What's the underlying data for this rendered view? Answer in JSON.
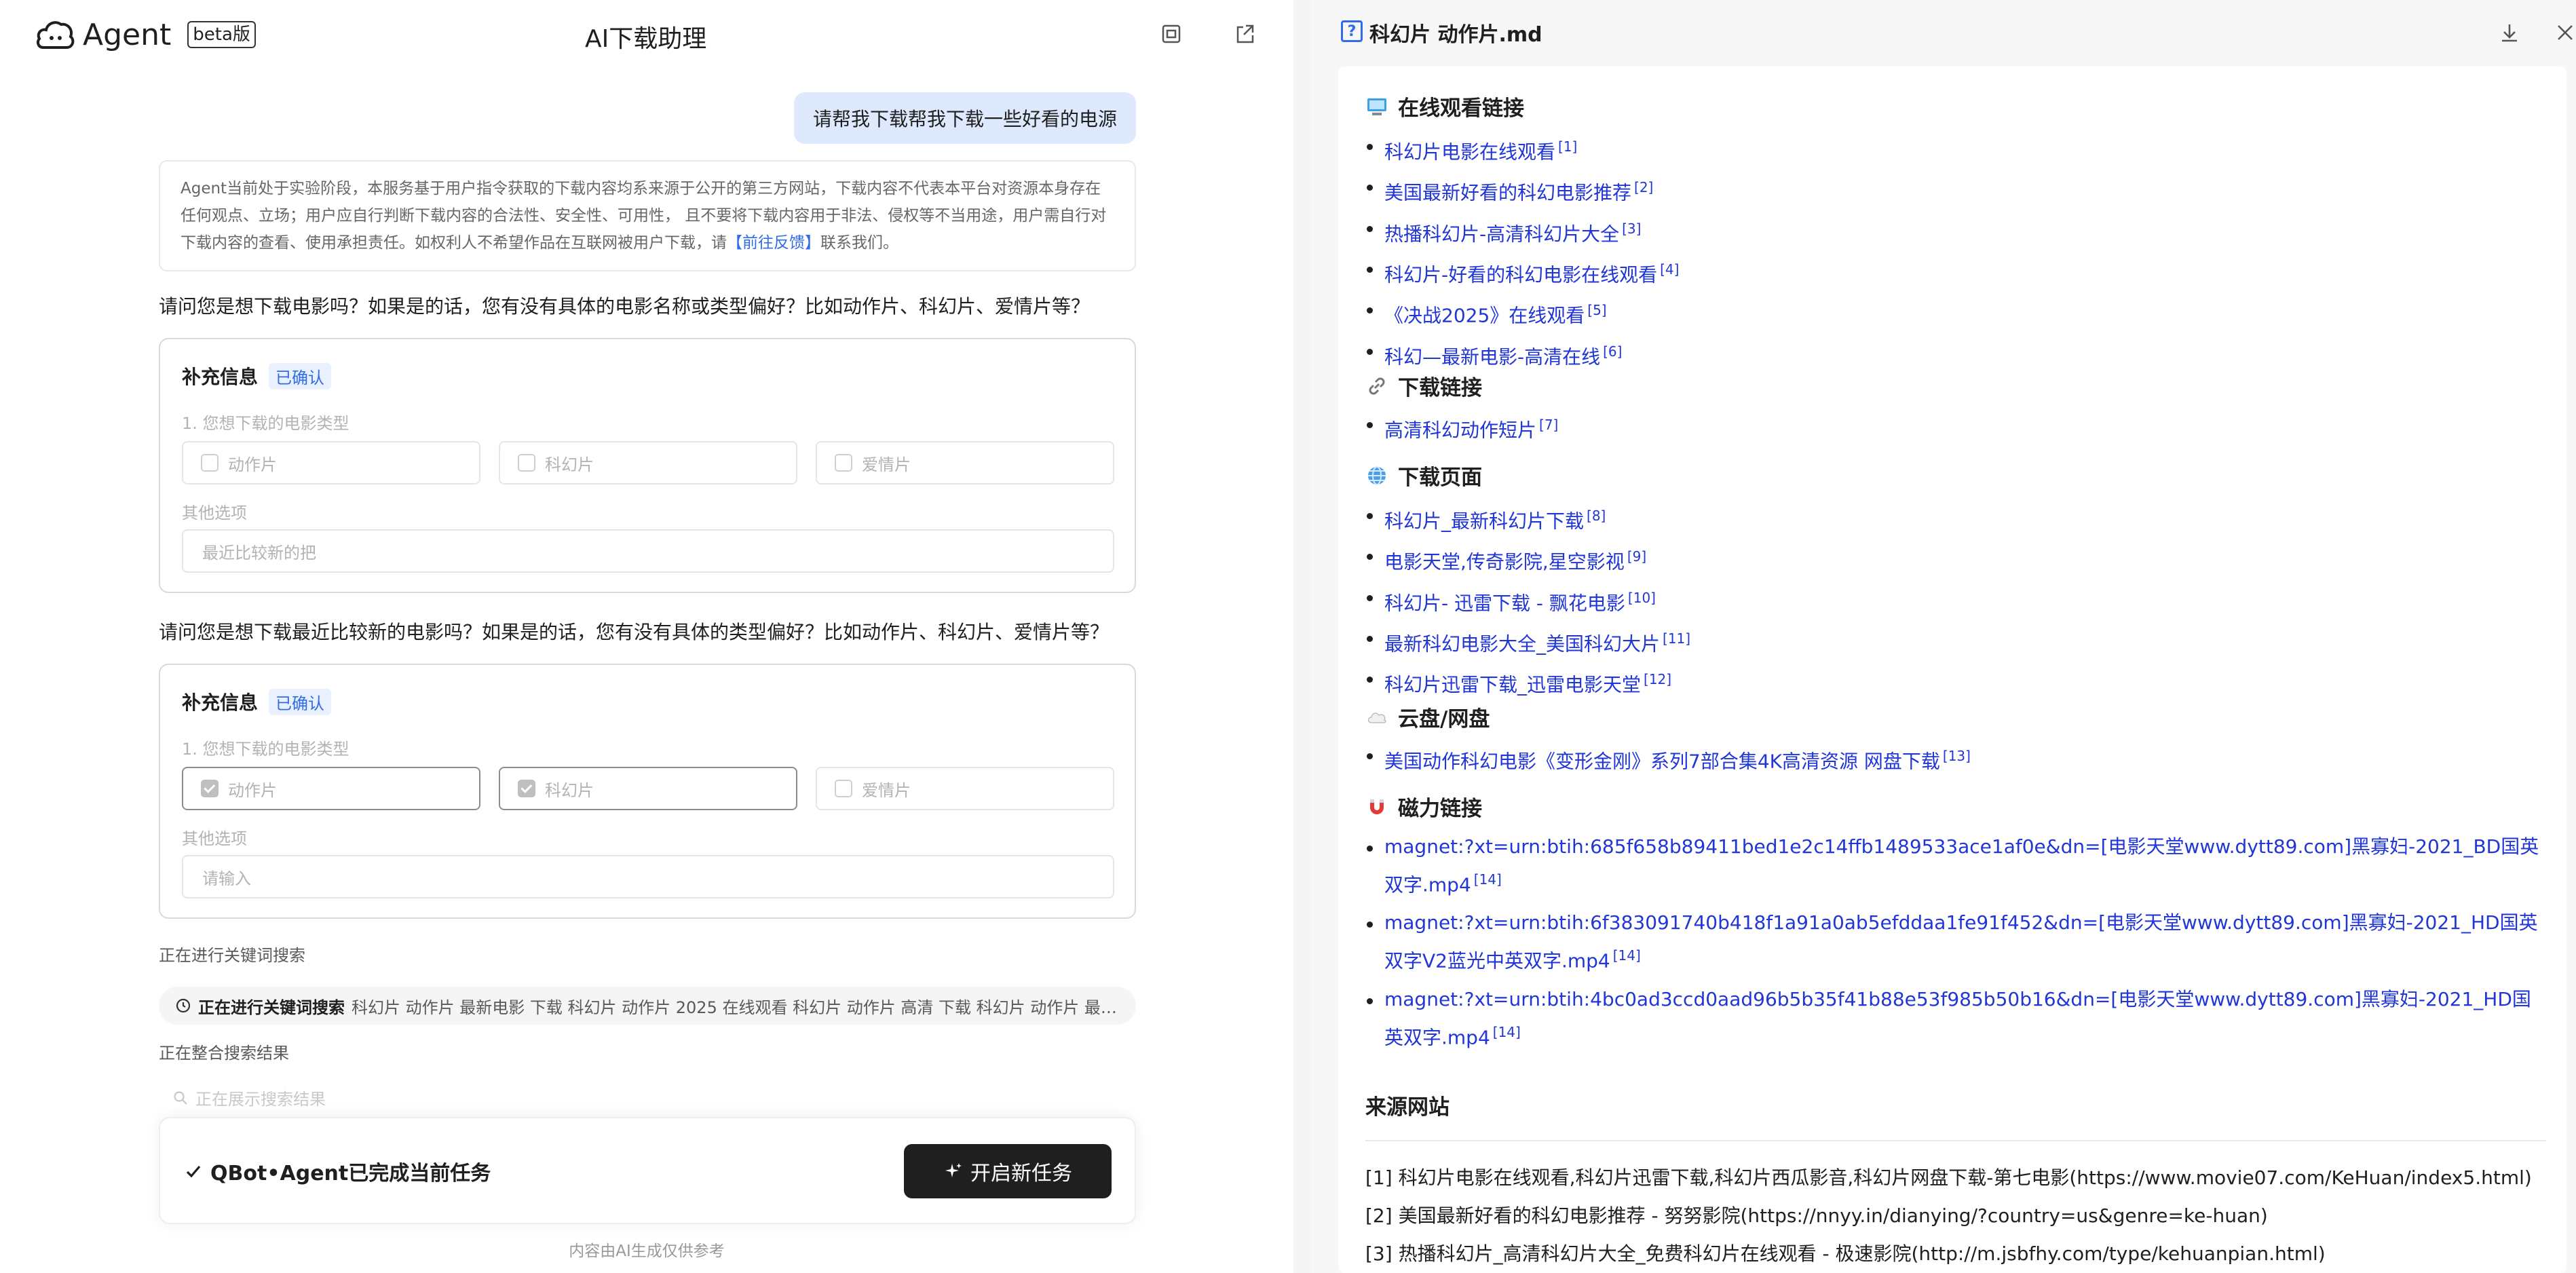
{
  "header": {
    "logo_text": "Agent",
    "beta": "beta版",
    "title": "AI下载助理"
  },
  "chat": {
    "user_message": "请帮我下载帮我下载一些好看的电源",
    "disclaimer": "Agent当前处于实验阶段，本服务基于用户指令获取的下载内容均系来源于公开的第三方网站，下载内容不代表本平台对资源本身存在任何观点、立场；用户应自行判断下载内容的合法性、安全性、可用性， 且不要将下载内容用于非法、侵权等不当用途，用户需自行对下载内容的查看、使用承担责任。如权利人不希望作品在互联网被用户下载，请",
    "disclaimer_link": "【前往反馈】",
    "disclaimer_tail": "联系我们。",
    "question1": "请问您是想下载电影吗？如果是的话，您有没有具体的电影名称或类型偏好？比如动作片、科幻片、爱情片等？",
    "question2": "请问您是想下载最近比较新的电影吗？如果是的话，您有没有具体的类型偏好？比如动作片、科幻片、爱情片等？",
    "card1": {
      "title": "补充信息",
      "badge": "已确认",
      "label1": "1. 您想下载的电影类型",
      "options": [
        "动作片",
        "科幻片",
        "爱情片"
      ],
      "label2": "其他选项",
      "field_value": "最近比较新的把"
    },
    "card2": {
      "title": "补充信息",
      "badge": "已确认",
      "label1": "1. 您想下载的电影类型",
      "options": [
        "动作片",
        "科幻片",
        "爱情片"
      ],
      "checked": [
        true,
        true,
        false
      ],
      "label2": "其他选项",
      "field_placeholder": "请输入"
    },
    "status_keyword": "正在进行关键词搜索",
    "search_bold": "正在进行关键词搜索",
    "search_keywords": "科幻片 动作片 最新电影 下载 科幻片 动作片 2025 在线观看 科幻片 动作片 高清 下载 科幻片 动作片 最新...",
    "status_merge": "正在整合搜索结果",
    "status_show": "正在展示搜索结果",
    "done_text": "QBot•Agent已完成当前任务",
    "new_task": "开启新任务",
    "footer_note": "内容由AI生成仅供参考"
  },
  "doc": {
    "title": "科幻片 动作片.md",
    "sections": {
      "online": {
        "title": "在线观看链接",
        "items": [
          {
            "text": "科幻片电影在线观看",
            "ref": "[1]"
          },
          {
            "text": "美国最新好看的科幻电影推荐",
            "ref": "[2]"
          },
          {
            "text": "热播科幻片-高清科幻片大全",
            "ref": "[3]"
          },
          {
            "text": "科幻片-好看的科幻电影在线观看",
            "ref": "[4]"
          },
          {
            "text": "《决战2025》在线观看",
            "ref": "[5]"
          },
          {
            "text": "科幻—最新电影-高清在线",
            "ref": "[6]"
          }
        ]
      },
      "download_links": {
        "title": "下载链接",
        "items": [
          {
            "text": "高清科幻动作短片",
            "ref": "[7]"
          }
        ]
      },
      "download_pages": {
        "title": "下载页面",
        "items": [
          {
            "text": "科幻片_最新科幻片下载",
            "ref": "[8]"
          },
          {
            "text": "电影天堂,传奇影院,星空影视",
            "ref": "[9]"
          },
          {
            "text": "科幻片- 迅雷下载 - 飘花电影",
            "ref": "[10]"
          },
          {
            "text": "最新科幻电影大全_美国科幻大片",
            "ref": "[11]"
          },
          {
            "text": "科幻片迅雷下载_迅雷电影天堂",
            "ref": "[12]"
          }
        ]
      },
      "cloud": {
        "title": "云盘/网盘",
        "items": [
          {
            "text": "美国动作科幻电影《变形金刚》系列7部合集4K高清资源 网盘下载",
            "ref": "[13]"
          }
        ]
      },
      "magnet": {
        "title": "磁力链接",
        "items": [
          {
            "text": "magnet:?xt=urn:btih:685f658b89411bed1e2c14ffb1489533ace1af0e&dn=[电影天堂www.dytt89.com]黑寡妇-2021_BD国英双字.mp4",
            "ref": "[14]"
          },
          {
            "text": "magnet:?xt=urn:btih:6f383091740b418f1a91a0ab5efddaa1fe91f452&dn=[电影天堂www.dytt89.com]黑寡妇-2021_HD国英双字V2蓝光中英双字.mp4",
            "ref": "[14]"
          },
          {
            "text": "magnet:?xt=urn:btih:4bc0ad3ccd0aad96b5b35f41b88e53f985b50b16&dn=[电影天堂www.dytt89.com]黑寡妇-2021_HD国英双字.mp4",
            "ref": "[14]"
          }
        ]
      }
    },
    "sources_title": "来源网站",
    "sources": [
      "[1] 科幻片电影在线观看,科幻片迅雷下载,科幻片西瓜影音,科幻片网盘下载-第七电影(https://www.movie07.com/KeHuan/index5.html)",
      "[2] 美国最新好看的科幻电影推荐 - 努努影院(https://nnyy.in/dianying/?country=us&genre=ke-huan)",
      "[3] 热播科幻片_高清科幻片大全_免费科幻片在线观看 - 极速影院(http://m.jsbfhy.com/type/kehuanpian.html)"
    ]
  }
}
